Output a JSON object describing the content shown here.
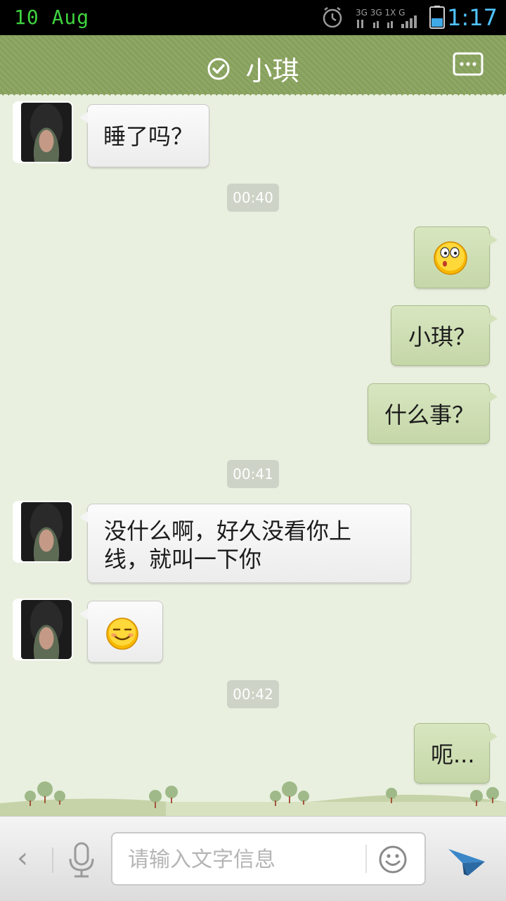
{
  "status_bar": {
    "date": "10 Aug",
    "time": "1:17",
    "time_color": "#4fc3ff",
    "date_color": "#3fd23f"
  },
  "header": {
    "title": "小琪",
    "status_icon": "check-circle-icon",
    "menu_icon": "chat-more-icon",
    "bar_color": "#8aa45f"
  },
  "messages": [
    {
      "side": "in",
      "text": "睡了吗？"
    },
    {
      "timestamp": "00:40"
    },
    {
      "side": "out",
      "emoji": "surprised-emoji"
    },
    {
      "side": "out",
      "text": "小琪？"
    },
    {
      "side": "out",
      "text": "什么事？"
    },
    {
      "timestamp": "00:41"
    },
    {
      "side": "in",
      "text_line1": "没什么啊，好久没看你上",
      "text_line2": "线，就叫一下你"
    },
    {
      "side": "in",
      "emoji": "smile-emoji"
    },
    {
      "timestamp": "00:42"
    },
    {
      "side": "out",
      "text": "呃..."
    }
  ],
  "input_bar": {
    "back_icon": "chevron-left-icon",
    "voice_icon": "microphone-icon",
    "placeholder": "请输入文字信息",
    "emoji_icon": "smiley-icon",
    "send_icon": "send-plane-icon"
  }
}
